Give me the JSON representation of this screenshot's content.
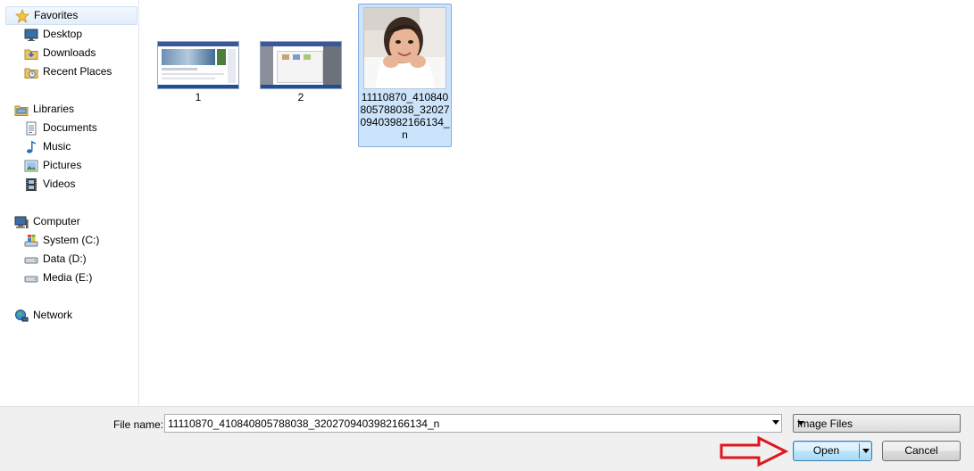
{
  "nav": {
    "favorites": {
      "label": "Favorites",
      "items": [
        {
          "label": "Desktop"
        },
        {
          "label": "Downloads"
        },
        {
          "label": "Recent Places"
        }
      ]
    },
    "libraries": {
      "label": "Libraries",
      "items": [
        {
          "label": "Documents"
        },
        {
          "label": "Music"
        },
        {
          "label": "Pictures"
        },
        {
          "label": "Videos"
        }
      ]
    },
    "computer": {
      "label": "Computer",
      "items": [
        {
          "label": "System (C:)"
        },
        {
          "label": "Data (D:)"
        },
        {
          "label": "Media (E:)"
        }
      ]
    },
    "network": {
      "label": "Network"
    }
  },
  "files": [
    {
      "name": "1",
      "selected": false
    },
    {
      "name": "2",
      "selected": false
    },
    {
      "name": "11110870_410840805788038_320270940398216613 4_n",
      "lines": [
        "11110870_410840",
        "805788038_32027",
        "09403982166134_",
        "n"
      ],
      "selected": true
    }
  ],
  "footer": {
    "file_name_label": "File name:",
    "file_name_value": "11110870_410840805788038_3202709403982166134_n",
    "file_type": "Image Files",
    "open_label": "Open",
    "cancel_label": "Cancel"
  },
  "colors": {
    "selection": "#cce4fb",
    "annotation_arrow": "#e0161e"
  }
}
